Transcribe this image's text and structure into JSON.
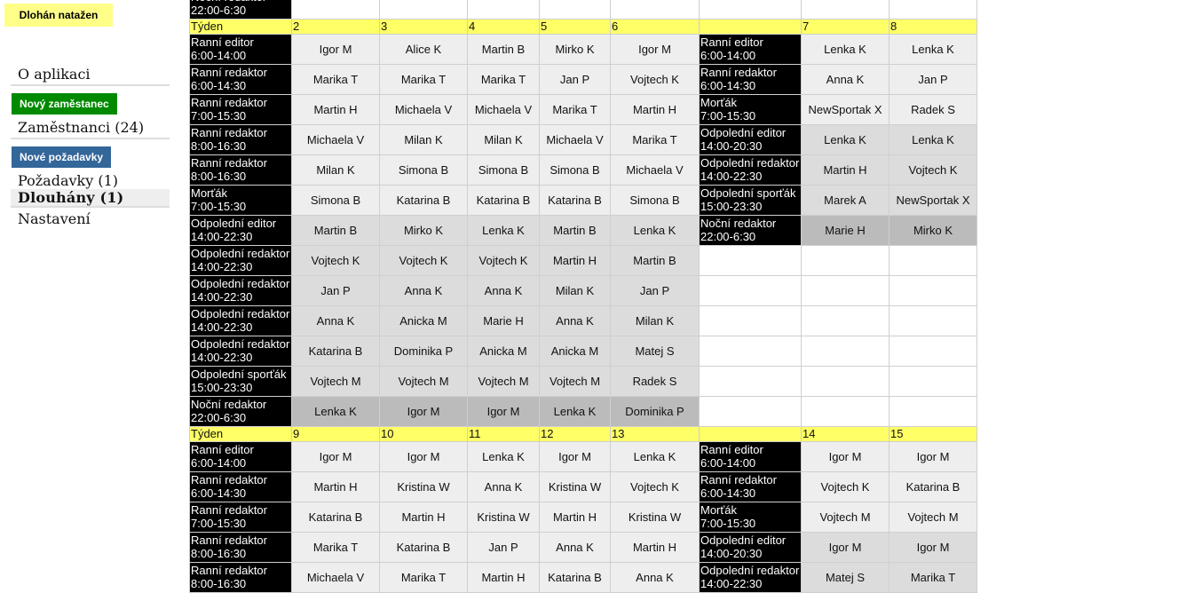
{
  "notice": "Dlohán natažen",
  "sidebar": {
    "about": "O aplikaci",
    "new_employee_button": "Nový zaměstanec",
    "employees": "Zaměstnanci (24)",
    "new_requests_button": "Nové požadavky",
    "requests": "Požadavky (1)",
    "long_shifts": "Dlouhány (1)",
    "settings": "Nastavení"
  },
  "colors": {
    "week_header": "#ffff66",
    "shift_label": "#000000",
    "morning_cell": "#eeeeee",
    "afternoon_cell": "#dcdcdc",
    "night_cell": "#bbbbbb",
    "notice": "#ffff88",
    "green_button": "#008a00",
    "blue_button": "#336699"
  },
  "schedule": {
    "top_partial_row": {
      "label": "Noční redaktor",
      "time": "22:00-6:30"
    },
    "week_label": "Týden",
    "weekday_shifts": [
      {
        "name": "Ranní editor",
        "time": "6:00-14:00",
        "type": "m"
      },
      {
        "name": "Ranní redaktor",
        "time": "6:00-14:30",
        "type": "m"
      },
      {
        "name": "Ranní redaktor",
        "time": "7:00-15:30",
        "type": "m"
      },
      {
        "name": "Ranní redaktor",
        "time": "8:00-16:30",
        "type": "m"
      },
      {
        "name": "Ranní redaktor",
        "time": "8:00-16:30",
        "type": "m"
      },
      {
        "name": "Morťák",
        "time": "7:00-15:30",
        "type": "m"
      },
      {
        "name": "Odpolední editor",
        "time": "14:00-22:30",
        "type": "a"
      },
      {
        "name": "Odpolední redaktor",
        "time": "14:00-22:30",
        "type": "a"
      },
      {
        "name": "Odpolední redaktor",
        "time": "14:00-22:30",
        "type": "a"
      },
      {
        "name": "Odpolední redaktor",
        "time": "14:00-22:30",
        "type": "a"
      },
      {
        "name": "Odpolední redaktor",
        "time": "14:00-22:30",
        "type": "a"
      },
      {
        "name": "Odpolední sporťák",
        "time": "15:00-23:30",
        "type": "a"
      },
      {
        "name": "Noční redaktor",
        "time": "22:00-6:30",
        "type": "n"
      }
    ],
    "weekend_shifts": [
      {
        "name": "Ranní editor",
        "time": "6:00-14:00",
        "type": "m"
      },
      {
        "name": "Ranní redaktor",
        "time": "6:00-14:30",
        "type": "m"
      },
      {
        "name": "Morťák",
        "time": "7:00-15:30",
        "type": "m"
      },
      {
        "name": "Odpolední editor",
        "time": "14:00-20:30",
        "type": "a"
      },
      {
        "name": "Odpolední redaktor",
        "time": "14:00-22:30",
        "type": "a"
      },
      {
        "name": "Odpolední sporťák",
        "time": "15:00-23:30",
        "type": "a"
      },
      {
        "name": "Noční redaktor",
        "time": "22:00-6:30",
        "type": "n"
      }
    ],
    "weeks": [
      {
        "weekday_days": [
          "2",
          "3",
          "4",
          "5",
          "6"
        ],
        "weekend_days": [
          "7",
          "8"
        ],
        "weekday_rows": [
          [
            "Igor M",
            "Alice K",
            "Martin B",
            "Mirko K",
            "Igor M"
          ],
          [
            "Marika T",
            "Marika T",
            "Marika T",
            "Jan P",
            "Vojtech K"
          ],
          [
            "Martin H",
            "Michaela V",
            "Michaela V",
            "Marika T",
            "Martin H"
          ],
          [
            "Michaela V",
            "Milan K",
            "Milan K",
            "Michaela V",
            "Marika T"
          ],
          [
            "Milan K",
            "Simona B",
            "Simona B",
            "Simona B",
            "Michaela V"
          ],
          [
            "Simona B",
            "Katarina B",
            "Katarina B",
            "Katarina B",
            "Simona B"
          ],
          [
            "Martin B",
            "Mirko K",
            "Lenka K",
            "Martin B",
            "Lenka K"
          ],
          [
            "Vojtech K",
            "Vojtech K",
            "Vojtech K",
            "Martin H",
            "Martin B"
          ],
          [
            "Jan P",
            "Anna K",
            "Anna K",
            "Milan K",
            "Jan P"
          ],
          [
            "Anna K",
            "Anicka M",
            "Marie H",
            "Anna K",
            "Milan K"
          ],
          [
            "Katarina B",
            "Dominika P",
            "Anicka M",
            "Anicka M",
            "Matej S"
          ],
          [
            "Vojtech M",
            "Vojtech M",
            "Vojtech M",
            "Vojtech M",
            "Radek S"
          ],
          [
            "Lenka K",
            "Igor M",
            "Igor M",
            "Lenka K",
            "Dominika P"
          ]
        ],
        "weekend_rows": [
          [
            "Lenka K",
            "Lenka K"
          ],
          [
            "Anna K",
            "Jan P"
          ],
          [
            "NewSportak X",
            "Radek S"
          ],
          [
            "Lenka K",
            "Lenka K"
          ],
          [
            "Martin H",
            "Vojtech K"
          ],
          [
            "Marek A",
            "NewSportak X"
          ],
          [
            "Marie H",
            "Mirko K"
          ]
        ]
      },
      {
        "weekday_days": [
          "9",
          "10",
          "11",
          "12",
          "13"
        ],
        "weekend_days": [
          "14",
          "15"
        ],
        "weekday_rows": [
          [
            "Igor M",
            "Igor M",
            "Lenka K",
            "Igor M",
            "Lenka K"
          ],
          [
            "Martin H",
            "Kristina W",
            "Anna K",
            "Kristina W",
            "Vojtech K"
          ],
          [
            "Katarina B",
            "Martin H",
            "Kristina W",
            "Martin H",
            "Kristina W"
          ],
          [
            "Marika T",
            "Katarina B",
            "Jan P",
            "Anna K",
            "Martin H"
          ],
          [
            "Michaela V",
            "Marika T",
            "Martin H",
            "Katarina B",
            "Anna K"
          ]
        ],
        "weekend_rows": [
          [
            "Igor M",
            "Igor M"
          ],
          [
            "Vojtech K",
            "Katarina B"
          ],
          [
            "Vojtech M",
            "Vojtech M"
          ],
          [
            "Igor M",
            "Igor M"
          ],
          [
            "Matej S",
            "Marika T"
          ]
        ]
      }
    ]
  }
}
